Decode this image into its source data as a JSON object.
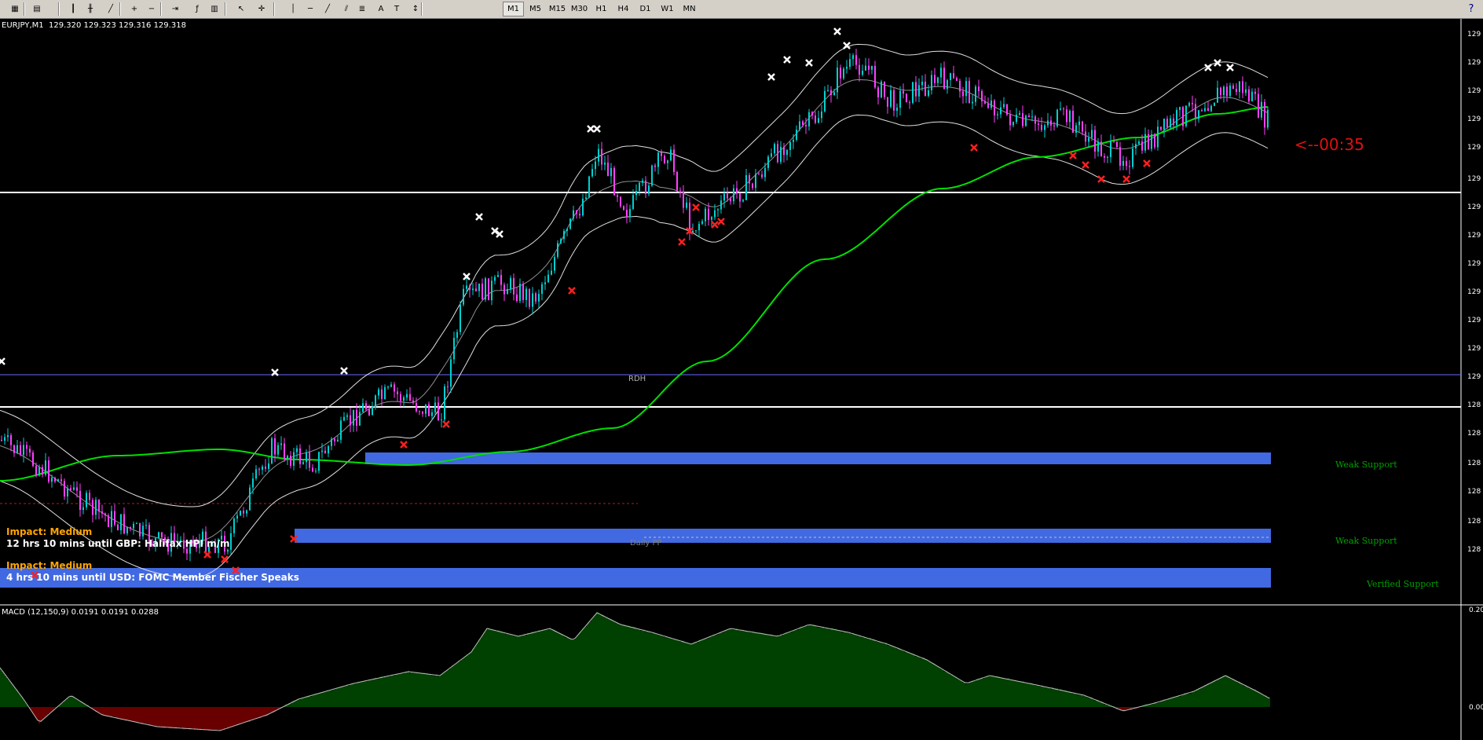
{
  "toolbar": {
    "icon_buttons": [
      {
        "name": "new-chart-icon",
        "glyph": "▦"
      },
      {
        "name": "profiles-icon",
        "glyph": "▤"
      },
      {
        "name": "bar-chart-icon",
        "glyph": "┃"
      },
      {
        "name": "candlestick-icon",
        "glyph": "╫"
      },
      {
        "name": "line-chart-icon",
        "glyph": "╱"
      },
      {
        "name": "zoom-in-icon",
        "glyph": "+"
      },
      {
        "name": "zoom-out-icon",
        "glyph": "−"
      },
      {
        "name": "chart-shift-icon",
        "glyph": "⇥"
      },
      {
        "name": "indicators-icon",
        "glyph": "ƒ"
      },
      {
        "name": "templates-icon",
        "glyph": "▥"
      },
      {
        "name": "cursor-icon",
        "glyph": "↖"
      },
      {
        "name": "crosshair-icon",
        "glyph": "✛"
      },
      {
        "name": "vertical-line-icon",
        "glyph": "│"
      },
      {
        "name": "horizontal-line-icon",
        "glyph": "─"
      },
      {
        "name": "trendline-icon",
        "glyph": "╱"
      },
      {
        "name": "equidistant-channel-icon",
        "glyph": "⫽"
      },
      {
        "name": "fibonacci-icon",
        "glyph": "≣"
      },
      {
        "name": "text-icon",
        "glyph": "A"
      },
      {
        "name": "text-label-icon",
        "glyph": "T"
      },
      {
        "name": "arrows-icon",
        "glyph": "↕"
      }
    ],
    "timeframes": [
      "M1",
      "M5",
      "M15",
      "M30",
      "H1",
      "H4",
      "D1",
      "W1",
      "MN"
    ],
    "active_timeframe": "M1",
    "help_glyph": "?"
  },
  "chart": {
    "symbol_line": "EURJPY,M1  129.320 129.323 129.316 129.318",
    "countdown": "<--00:35",
    "rdh_label": "RDH",
    "daily_pp_label": "Daily PP",
    "price_axis_labels": [
      "129",
      "129",
      "129",
      "129",
      "129",
      "129",
      "129",
      "129",
      "129",
      "129",
      "129",
      "129",
      "129",
      "128",
      "128",
      "128",
      "128",
      "128",
      "128"
    ],
    "zones": [
      {
        "label": "Weak Support"
      },
      {
        "label": "Weak Support"
      },
      {
        "label": "Verified Support"
      }
    ],
    "news": [
      {
        "impact": "Impact: Medium",
        "title": "12 hrs 10 mins until GBP: Halifax HPI m/m"
      },
      {
        "impact": "Impact: Medium",
        "title": "4 hrs 10 mins until USD: FOMC Member Fischer Speaks"
      }
    ],
    "colors": {
      "bull_candle": "#00d0d0",
      "bear_candle": "#ff40ff",
      "zone": "#4169e1",
      "ma_green": "#00e000",
      "envelope": "#e0e0e0",
      "macd_positive": "#008000",
      "macd_negative": "#d00000",
      "marker_top": "#ffffff",
      "marker_bottom": "#ff2020"
    }
  },
  "macd": {
    "label": "MACD (12,150,9) 0.0191 0.0191 0.0288",
    "axis_labels": [
      "0.20",
      "0.00"
    ]
  }
}
